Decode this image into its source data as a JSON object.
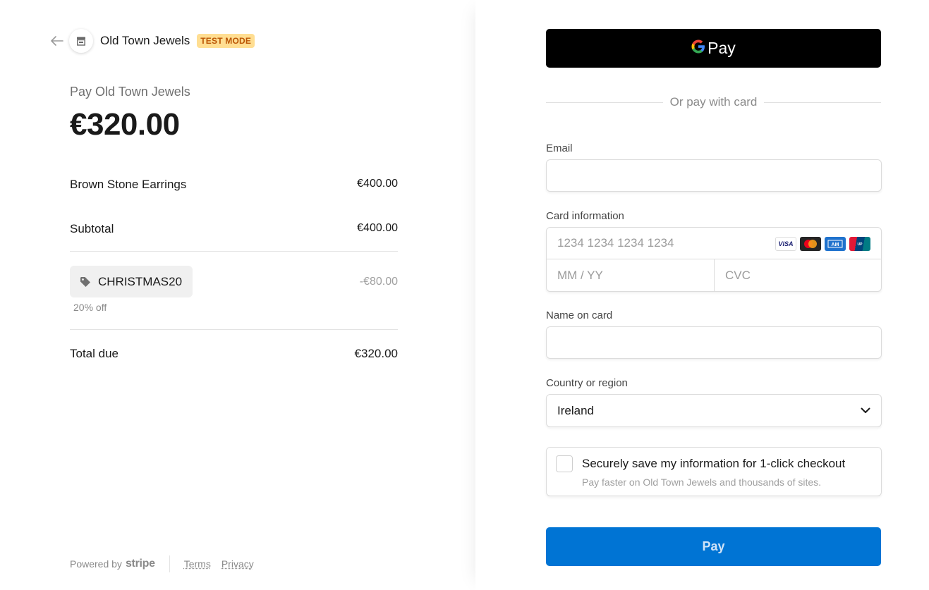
{
  "merchant": {
    "name": "Old Town Jewels",
    "badge": "TEST MODE"
  },
  "summary": {
    "pay_label": "Pay Old Town Jewels",
    "amount": "€320.00",
    "line_item": {
      "name": "Brown Stone Earrings",
      "price": "€400.00"
    },
    "subtotal": {
      "label": "Subtotal",
      "value": "€400.00"
    },
    "promo": {
      "code": "CHRISTMAS20",
      "description": "20% off",
      "amount": "-€80.00"
    },
    "total": {
      "label": "Total due",
      "value": "€320.00"
    }
  },
  "footer": {
    "powered_by": "Powered by",
    "brand": "stripe",
    "terms": "Terms",
    "privacy": "Privacy"
  },
  "checkout": {
    "gpay_label": "Pay",
    "divider_text": "Or pay with card",
    "email_label": "Email",
    "email_value": "",
    "card_label": "Card information",
    "card_number_placeholder": "1234 1234 1234 1234",
    "card_brands": [
      "VISA",
      "mastercard",
      "amex",
      "unionpay"
    ],
    "expiry_placeholder": "MM / YY",
    "cvc_placeholder": "CVC",
    "name_label": "Name on card",
    "name_value": "",
    "country_label": "Country or region",
    "country_value": "Ireland",
    "save_title": "Securely save my information for 1-click checkout",
    "save_subtitle": "Pay faster on Old Town Jewels and thousands of sites.",
    "pay_button": "Pay"
  },
  "colors": {
    "pay_button": "#0074d4",
    "test_badge_bg": "#ffde92",
    "test_badge_text": "#bb5504"
  }
}
